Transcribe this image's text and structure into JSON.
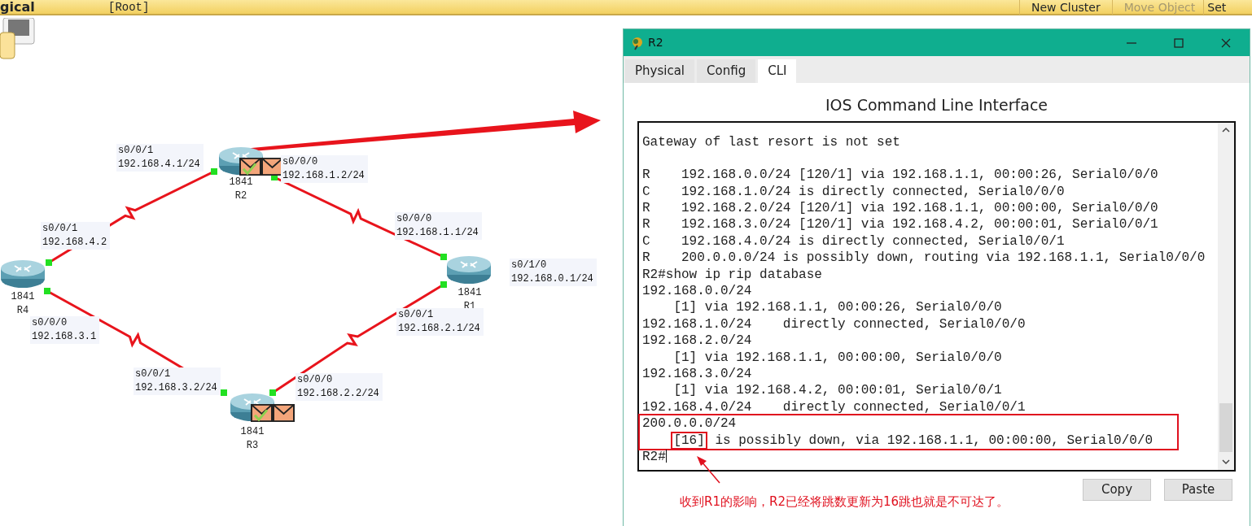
{
  "toolbar": {
    "workspace": "gical",
    "path": "[Root]",
    "buttons": [
      {
        "label": "New Cluster",
        "disabled": false
      },
      {
        "label": "Move Object",
        "disabled": true
      },
      {
        "label": "Set",
        "disabled": false
      }
    ]
  },
  "topology": {
    "routers": [
      {
        "model": "1841",
        "name": "R2",
        "pdu": true
      },
      {
        "model": "1841",
        "name": "R1",
        "pdu": false
      },
      {
        "model": "1841",
        "name": "R4",
        "pdu": false
      },
      {
        "model": "1841",
        "name": "R3",
        "pdu": true
      }
    ],
    "interface_labels": [
      {
        "interface": "s0/0/1",
        "address": "192.168.4.1/24"
      },
      {
        "interface": "s0/0/0",
        "address": "192.168.1.2/24"
      },
      {
        "interface": "s0/0/1",
        "address": "192.168.4.2"
      },
      {
        "interface": "s0/0/0",
        "address": "192.168.1.1/24"
      },
      {
        "interface": "s0/1/0",
        "address": "192.168.0.1/24"
      },
      {
        "interface": "s0/0/0",
        "address": "192.168.3.1"
      },
      {
        "interface": "s0/0/1",
        "address": "192.168.2.1/24"
      },
      {
        "interface": "s0/0/1",
        "address": "192.168.3.2/24"
      },
      {
        "interface": "s0/0/0",
        "address": "192.168.2.2/24"
      }
    ]
  },
  "dialog": {
    "title": "R2",
    "tabs": [
      {
        "label": "Physical",
        "selected": false
      },
      {
        "label": "Config",
        "selected": false
      },
      {
        "label": "CLI",
        "selected": true
      }
    ],
    "heading": "IOS Command Line Interface",
    "terminal": {
      "blocks": [
        {
          "kind": "paragraph",
          "lines": [
            {
              "text": "Gateway of last resort is not set"
            }
          ]
        },
        {
          "kind": "plain",
          "lines": [
            {
              "text": "R    192.168.0.0/24 [120/1] via 192.168.1.1, 00:00:26, Serial0/0/0"
            },
            {
              "text": "C    192.168.1.0/24 is directly connected, Serial0/0/0"
            },
            {
              "text": "R    192.168.2.0/24 [120/1] via 192.168.1.1, 00:00:00, Serial0/0/0"
            },
            {
              "text": "R    192.168.3.0/24 [120/1] via 192.168.4.2, 00:00:01, Serial0/0/1"
            },
            {
              "text": "C    192.168.4.0/24 is directly connected, Serial0/0/1"
            },
            {
              "text": "R    200.0.0.0/24 is possibly down, routing via 192.168.1.1, Serial0/0/0"
            },
            {
              "text": "R2#show ip rip database"
            },
            {
              "text": "192.168.0.0/24"
            },
            {
              "text": "[1] via 192.168.1.1, 00:00:26, Serial0/0/0",
              "indented": true
            },
            {
              "text": "192.168.1.0/24    directly connected, Serial0/0/0"
            },
            {
              "text": "192.168.2.0/24"
            },
            {
              "text": "[1] via 192.168.1.1, 00:00:00, Serial0/0/0",
              "indented": true
            },
            {
              "text": "192.168.3.0/24"
            },
            {
              "text": "[1] via 192.168.4.2, 00:00:01, Serial0/0/1",
              "indented": true
            },
            {
              "text": "192.168.4.0/24    directly connected, Serial0/0/1"
            }
          ]
        },
        {
          "kind": "highlighted",
          "lines": [
            {
              "text": "200.0.0.0/24"
            },
            {
              "boxed": "[16]",
              "text": " is possibly down, via 192.168.1.1, 00:00:00, Serial0/0/0",
              "indented": true
            }
          ]
        },
        {
          "kind": "plain",
          "lines": [
            {
              "text": "R2#",
              "cursor": true
            }
          ]
        }
      ]
    },
    "buttons": [
      "Copy",
      "Paste"
    ]
  },
  "annotation": {
    "text": "收到R1的影响，R2已经将跳数更新为16跳也就是不可达了。"
  }
}
